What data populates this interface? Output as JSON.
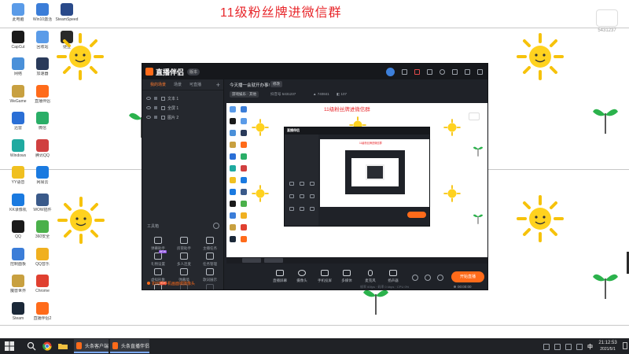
{
  "desktop": {
    "banner": "11级粉丝牌进微信群",
    "watermark_id": "5431237",
    "icons_col1": [
      {
        "label": "此电脑",
        "color": "#5a9be8"
      },
      {
        "label": "CapCut",
        "color": "#1a1a1a"
      },
      {
        "label": "网络",
        "color": "#4a90d9"
      },
      {
        "label": "WeGame",
        "color": "#c8a040"
      },
      {
        "label": "迅雷",
        "color": "#2a6fd6"
      },
      {
        "label": "Windows",
        "color": "#1faaa0"
      },
      {
        "label": "YY语音",
        "color": "#f0c020"
      },
      {
        "label": "KK录像机",
        "color": "#1a7ae0"
      },
      {
        "label": "QQ",
        "color": "#1a1a1a"
      },
      {
        "label": "控制面板",
        "color": "#3b7dd8"
      },
      {
        "label": "魔兽世界",
        "color": "#c8a040"
      },
      {
        "label": "Steam",
        "color": "#1b2838"
      }
    ],
    "icons_col2": [
      {
        "label": "Win10激活",
        "color": "#3b7dd8"
      },
      {
        "label": "回收站",
        "color": "#5a9be8"
      },
      {
        "label": "加速器",
        "color": "#2a3a5a"
      },
      {
        "label": "直播伴侣",
        "color": "#ff6b1a"
      },
      {
        "label": "微信",
        "color": "#2aae67"
      },
      {
        "label": "腾讯QQ",
        "color": "#d04040"
      },
      {
        "label": "网易云",
        "color": "#1a7ae0"
      },
      {
        "label": "WOW插件",
        "color": "#3a5a8a"
      },
      {
        "label": "360安全",
        "color": "#4ab04a"
      },
      {
        "label": "QQ音乐",
        "color": "#f0b020"
      },
      {
        "label": "Chrome",
        "color": "#e04030"
      },
      {
        "label": "直播伴侣2",
        "color": "#ff6b1a"
      }
    ],
    "icons_col3": [
      {
        "label": "SteamSpeed",
        "color": "#2a4a8a"
      },
      {
        "label": "便签",
        "color": "#2a2a2a"
      }
    ]
  },
  "app": {
    "name": "直播伴侣",
    "badge": "版本",
    "scene_tabs": [
      "我的场景",
      "场景",
      "可直播"
    ],
    "sources": [
      {
        "name": "文本 1"
      },
      {
        "name": "全屏 1"
      },
      {
        "name": "图片 2"
      }
    ],
    "toolbox_title": "工具箱",
    "tools": [
      {
        "label": "弹幕助手",
        "tag": ""
      },
      {
        "label": "房管助手",
        "tag": ""
      },
      {
        "label": "主播任务",
        "tag": ""
      },
      {
        "label": "礼物设置",
        "tag": "NEW"
      },
      {
        "label": "多人连麦",
        "tag": ""
      },
      {
        "label": "任务管理",
        "tag": ""
      },
      {
        "label": "虚拟形象",
        "tag": ""
      },
      {
        "label": "弹幕墙",
        "tag": ""
      },
      {
        "label": "歌词展示",
        "tag": ""
      },
      {
        "label": "更多",
        "tag": "HOT"
      },
      {
        "label": "",
        "tag": ""
      },
      {
        "label": "",
        "tag": ""
      }
    ],
    "promo": "如何把手机画面或摄像头",
    "room_title": "今天播一会就开办事!",
    "room_edit": "修改",
    "category": "游戏娱乐 · 其他",
    "stats": [
      {
        "label": "抖音号",
        "value": "5431237"
      },
      {
        "label": "",
        "value": "740841"
      },
      {
        "label": "",
        "value": "107"
      }
    ],
    "preview_banner": "11级粉丝牌进微信群",
    "controls": [
      {
        "label": "直播屏幕"
      },
      {
        "label": "摄像头"
      },
      {
        "label": "手机投屏"
      },
      {
        "label": "多媒体"
      },
      {
        "label": "麦克风"
      },
      {
        "label": "扬声器"
      }
    ],
    "start_label": "开始直播",
    "live_time": "00:00:00",
    "status_line": "帧率 60fps · 码率 0 kbps · CPU 0%"
  },
  "taskbar": {
    "windows": [
      {
        "label": "头条客户端"
      },
      {
        "label": "头条直播伴侣"
      }
    ],
    "time": "21:12:53",
    "date": "2021/5/1",
    "ime": "中"
  }
}
